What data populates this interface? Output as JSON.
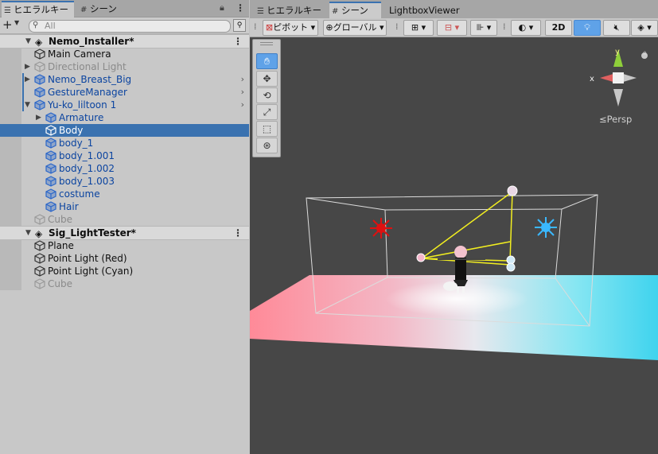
{
  "hierarchy": {
    "tabs": [
      {
        "label": "ヒエラルキー",
        "icon": "list-icon"
      },
      {
        "label": "シーン",
        "icon": "grid-icon"
      }
    ],
    "search_placeholder": "All",
    "add_label": "+",
    "scenes": [
      {
        "name": "Nemo_Installer*",
        "rows": [
          {
            "label": "Main Camera",
            "indent": 1,
            "style": "normal",
            "arrow": ""
          },
          {
            "label": "Directional Light",
            "indent": 1,
            "style": "dim",
            "arrow": "right"
          },
          {
            "label": "Nemo_Breast_Big",
            "indent": 1,
            "style": "prefab",
            "arrow": "right",
            "chevron": true
          },
          {
            "label": "GestureManager",
            "indent": 1,
            "style": "prefab",
            "arrow": "",
            "chevron": true
          },
          {
            "label": "Yu-ko_liltoon 1",
            "indent": 1,
            "style": "prefab",
            "arrow": "down",
            "chevron": true
          },
          {
            "label": "Armature",
            "indent": 2,
            "style": "prefab",
            "arrow": "right"
          },
          {
            "label": "Body",
            "indent": 2,
            "style": "selected",
            "arrow": ""
          },
          {
            "label": "body_1",
            "indent": 2,
            "style": "prefab",
            "arrow": ""
          },
          {
            "label": "body_1.001",
            "indent": 2,
            "style": "prefab",
            "arrow": ""
          },
          {
            "label": "body_1.002",
            "indent": 2,
            "style": "prefab",
            "arrow": ""
          },
          {
            "label": "body_1.003",
            "indent": 2,
            "style": "prefab",
            "arrow": ""
          },
          {
            "label": "costume",
            "indent": 2,
            "style": "prefab",
            "arrow": ""
          },
          {
            "label": "Hair",
            "indent": 2,
            "style": "prefab",
            "arrow": ""
          },
          {
            "label": "Cube",
            "indent": 1,
            "style": "dim",
            "arrow": ""
          }
        ]
      },
      {
        "name": "Sig_LightTester*",
        "rows": [
          {
            "label": "Plane",
            "indent": 1,
            "style": "normal",
            "arrow": ""
          },
          {
            "label": "Point Light (Red)",
            "indent": 1,
            "style": "normal",
            "arrow": ""
          },
          {
            "label": "Point Light (Cyan)",
            "indent": 1,
            "style": "normal",
            "arrow": ""
          },
          {
            "label": "Cube",
            "indent": 1,
            "style": "dim",
            "arrow": ""
          }
        ]
      }
    ]
  },
  "scene_view": {
    "tabs": [
      "ヒエラルキー",
      "シーン",
      "LightboxViewer"
    ],
    "active_tab": 1,
    "toolbar": {
      "pivot": "ピボット",
      "global": "グローバル",
      "mode_2d": "2D"
    },
    "tools": [
      "hand-icon",
      "move-icon",
      "rotate-icon",
      "scale-icon",
      "rect-icon",
      "transform-icon"
    ],
    "gizmo": {
      "x": "x",
      "y": "y",
      "projection": "≤Persp"
    },
    "colors": {
      "red_light": "#e02020",
      "cyan_light": "#3ab8ff",
      "selection": "#3a72b0"
    }
  }
}
